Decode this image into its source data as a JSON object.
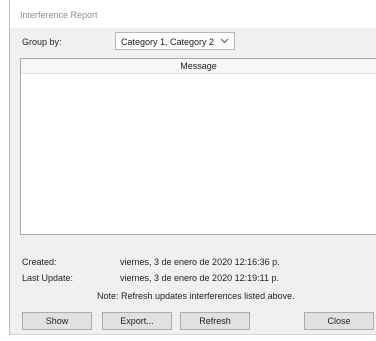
{
  "dialog": {
    "title": "Interference Report"
  },
  "group_by": {
    "label": "Group by:",
    "value": "Category 1, Category 2"
  },
  "list": {
    "header": "Message",
    "rows": []
  },
  "info": {
    "created_label": "Created:",
    "created_value": "viernes, 3 de enero de 2020 12:16:36 p.",
    "last_update_label": "Last Update:",
    "last_update_value": "viernes, 3 de enero de 2020 12:19:11 p.",
    "note": "Note: Refresh updates interferences listed above."
  },
  "buttons": {
    "show": "Show",
    "export": "Export...",
    "refresh": "Refresh",
    "close": "Close"
  },
  "icons": {
    "dropdown": "chevron-down-icon"
  }
}
